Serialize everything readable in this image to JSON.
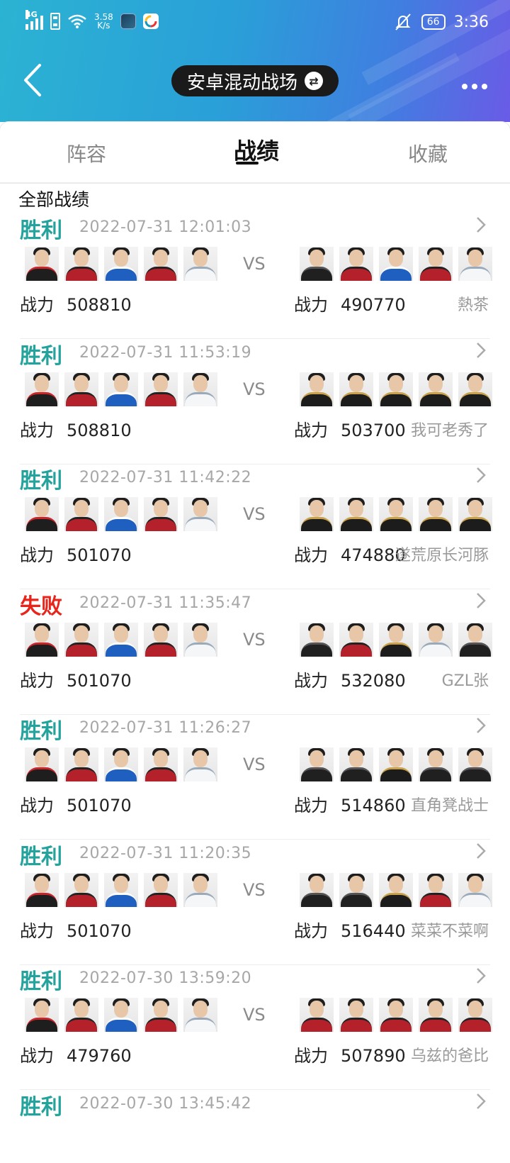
{
  "status_bar": {
    "network": "4G",
    "speed_value": "3.58",
    "speed_unit": "K/s",
    "battery": "66",
    "time": "3:36",
    "icons": [
      "signal-icon",
      "sim-icon",
      "wifi-icon",
      "app-icon-1",
      "app-icon-2",
      "mute-icon",
      "battery-icon"
    ]
  },
  "header": {
    "title": "安卓混动战场",
    "swap_icon": "⇄"
  },
  "tabs": [
    {
      "label": "阵容",
      "active": false
    },
    {
      "label": "战绩",
      "active": true
    },
    {
      "label": "收藏",
      "active": false
    }
  ],
  "section_title": "全部战绩",
  "power_label": "战力",
  "vs_label": "VS",
  "colors": {
    "win": "#23a39b",
    "lose": "#e8241b",
    "header_start": "#2bb3d3",
    "header_end": "#6a5be6"
  },
  "matches": [
    {
      "result": "胜利",
      "outcome": "win",
      "time": "2022-07-31  12:01:03",
      "my_power": "508810",
      "opp_power": "490770",
      "opp_player": "熱茶",
      "my_team": [
        "black-red",
        "red",
        "blue",
        "red",
        "white"
      ],
      "opp_team": [
        "black",
        "red",
        "blue",
        "red",
        "white"
      ]
    },
    {
      "result": "胜利",
      "outcome": "win",
      "time": "2022-07-31  11:53:19",
      "my_power": "508810",
      "opp_power": "503700",
      "opp_player": "我可老秀了",
      "my_team": [
        "black-red",
        "red",
        "blue",
        "red",
        "white"
      ],
      "opp_team": [
        "black-gold",
        "black-gold",
        "black-gold",
        "black-gold",
        "black-gold"
      ]
    },
    {
      "result": "胜利",
      "outcome": "win",
      "time": "2022-07-31  11:42:22",
      "my_power": "501070",
      "opp_power": "474880",
      "opp_player": "遂荒原长河豚",
      "my_team": [
        "black-red",
        "red",
        "blue",
        "red",
        "white"
      ],
      "opp_team": [
        "black-gold",
        "black-gold",
        "black-gold",
        "black-gold",
        "black-gold"
      ]
    },
    {
      "result": "失败",
      "outcome": "lose",
      "time": "2022-07-31  11:35:47",
      "my_power": "501070",
      "opp_power": "532080",
      "opp_player": "GZL张",
      "my_team": [
        "black-red",
        "red",
        "blue",
        "red",
        "white"
      ],
      "opp_team": [
        "black",
        "red",
        "black-gold",
        "white",
        "black"
      ]
    },
    {
      "result": "胜利",
      "outcome": "win",
      "time": "2022-07-31  11:26:27",
      "my_power": "501070",
      "opp_power": "514860",
      "opp_player": "直角凳战士",
      "my_team": [
        "black-red",
        "red",
        "blue",
        "red",
        "white"
      ],
      "opp_team": [
        "black",
        "black",
        "black-gold",
        "black",
        "black"
      ]
    },
    {
      "result": "胜利",
      "outcome": "win",
      "time": "2022-07-31  11:20:35",
      "my_power": "501070",
      "opp_power": "516440",
      "opp_player": "菜菜不菜啊",
      "my_team": [
        "black-red",
        "red",
        "blue",
        "red",
        "white"
      ],
      "opp_team": [
        "black",
        "black",
        "black-gold",
        "red",
        "white"
      ]
    },
    {
      "result": "胜利",
      "outcome": "win",
      "time": "2022-07-30  13:59:20",
      "my_power": "479760",
      "opp_power": "507890",
      "opp_player": "乌兹的爸比",
      "my_team": [
        "black-red",
        "red",
        "blue",
        "red",
        "white"
      ],
      "opp_team": [
        "red",
        "red",
        "red",
        "red",
        "red"
      ]
    },
    {
      "result": "胜利",
      "outcome": "win",
      "time": "2022-07-30  13:45:42",
      "my_power": "",
      "opp_power": "",
      "opp_player": "",
      "my_team": [],
      "opp_team": []
    }
  ]
}
